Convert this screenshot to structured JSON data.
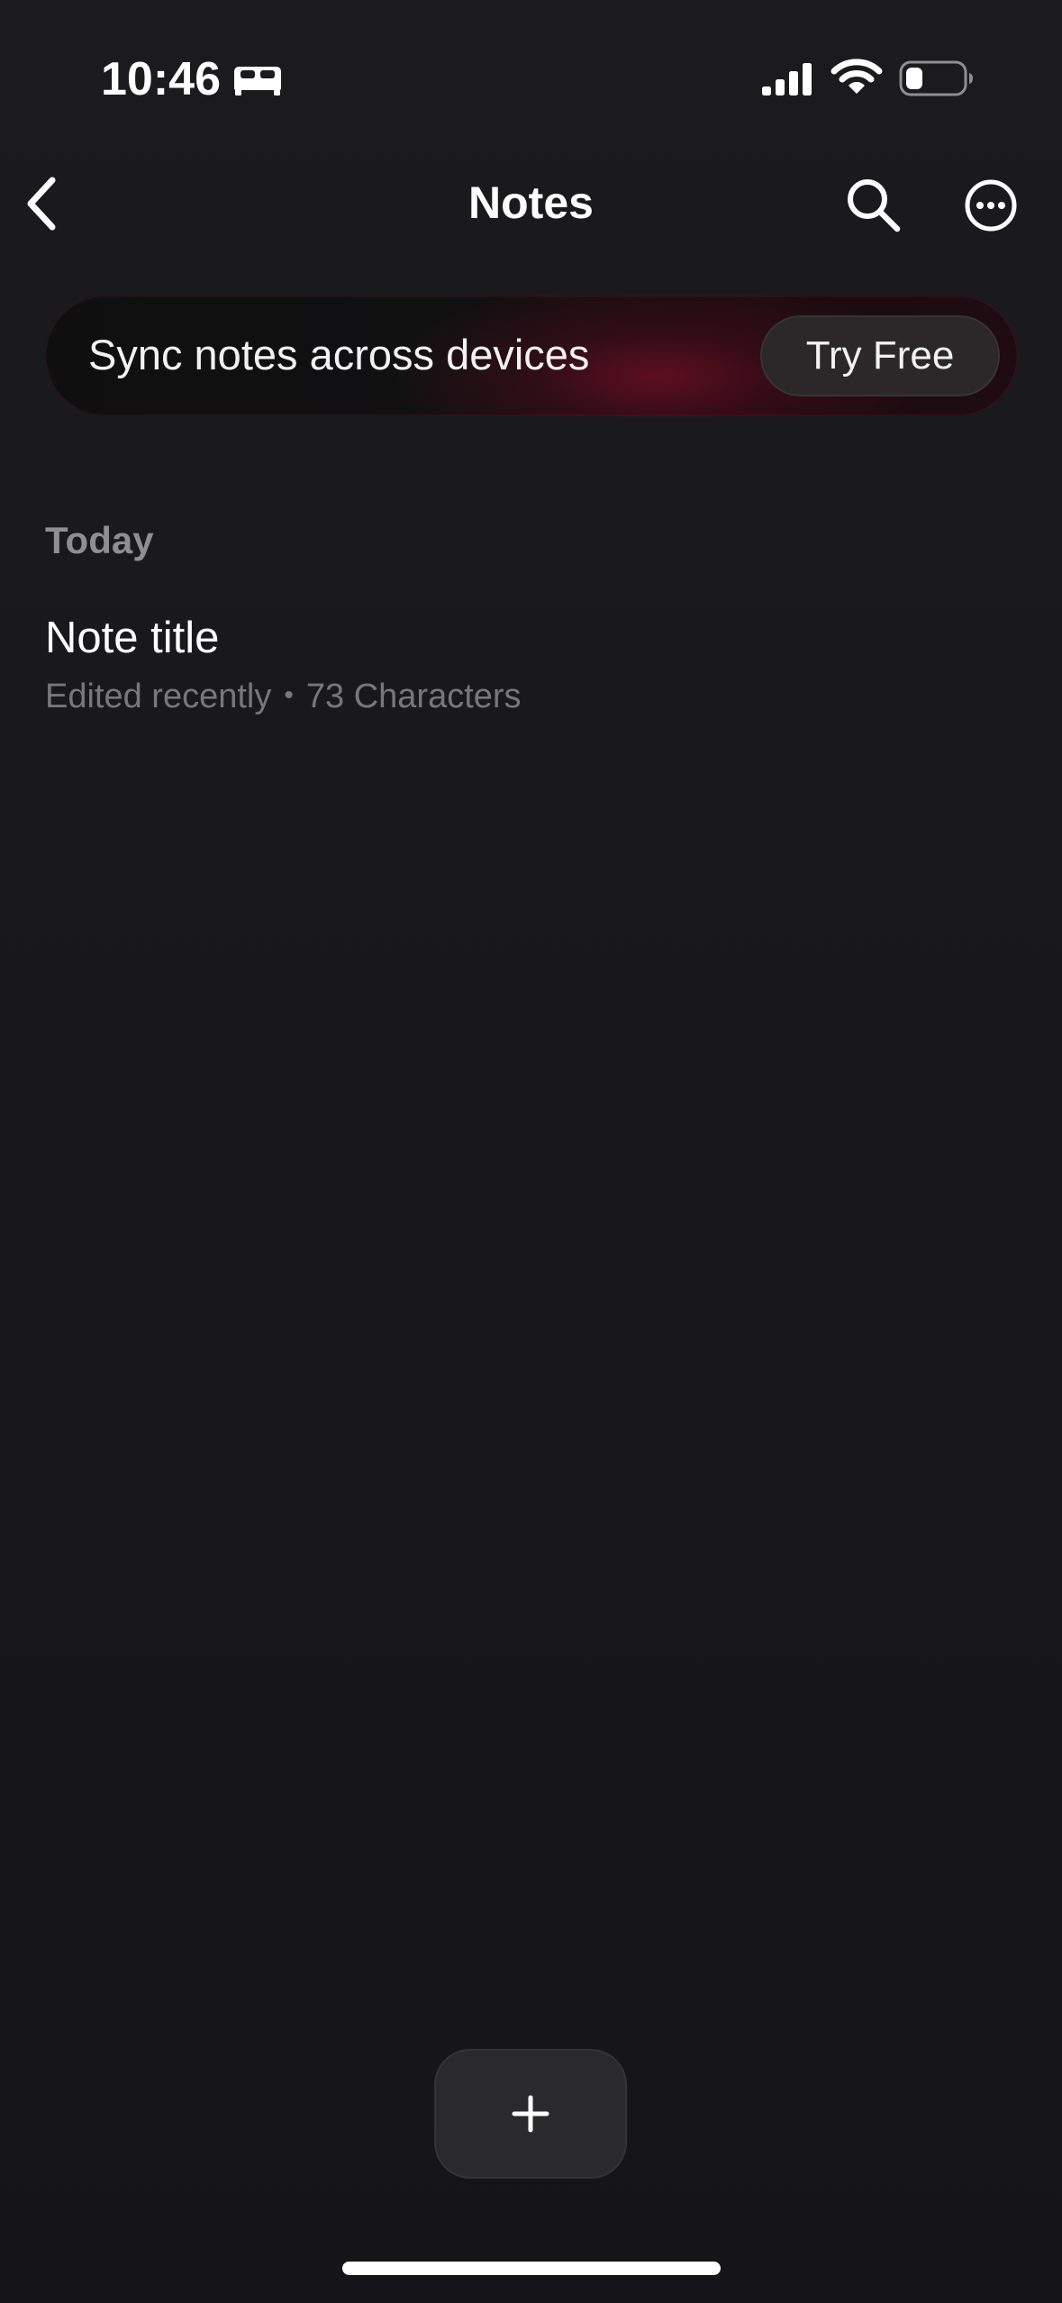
{
  "status_bar": {
    "time": "10:46",
    "focus_icon": "bed-icon",
    "signal_icon": "cellular-signal-icon",
    "wifi_icon": "wifi-icon",
    "battery_icon": "battery-icon",
    "battery_level": 0.3
  },
  "nav": {
    "title": "Notes",
    "back_icon": "chevron-left-icon",
    "search_icon": "search-icon",
    "more_icon": "ellipsis-circle-icon"
  },
  "banner": {
    "text": "Sync notes across devices",
    "button_label": "Try Free",
    "accent_color": "#8c102c"
  },
  "sections": [
    {
      "header": "Today",
      "notes": [
        {
          "title": "Note title",
          "edited": "Edited recently",
          "separator": "•",
          "characters": "73 Characters"
        }
      ]
    }
  ],
  "add_button": {
    "icon": "plus-icon"
  },
  "colors": {
    "background": "#19191c",
    "secondary_text": "#8e8e93",
    "tertiary_text": "#77777c",
    "button_surface": "#2a2a2d"
  }
}
